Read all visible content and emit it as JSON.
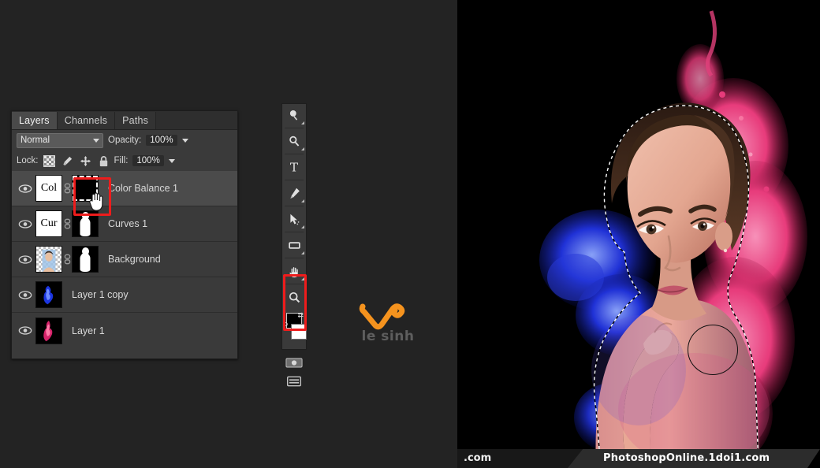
{
  "app": {
    "accent_red": "#ee1c1c",
    "panel_bg": "#3a3a3a",
    "workspace_bg": "#232323",
    "logo_orange": "#f5931e"
  },
  "layers_panel": {
    "tabs": [
      {
        "label": "Layers",
        "active": true
      },
      {
        "label": "Channels",
        "active": false
      },
      {
        "label": "Paths",
        "active": false
      }
    ],
    "blend_mode": "Normal",
    "opacity_label": "Opacity:",
    "opacity_value": "100%",
    "lock_label": "Lock:",
    "fill_label": "Fill:",
    "fill_value": "100%",
    "lock_icons": [
      "transparency-checker-icon",
      "brush-icon",
      "move-icon",
      "lock-all-icon"
    ],
    "layers": [
      {
        "name": "Color Balance 1",
        "thumb_text": "Col",
        "thumb_kind": "adjustment-text",
        "mask_kind": "black-empty",
        "selected": true,
        "visible": true,
        "mask_has_selection": true
      },
      {
        "name": "Curves 1",
        "thumb_text": "Cur",
        "thumb_kind": "adjustment-text",
        "mask_kind": "silhouette",
        "selected": false,
        "visible": true,
        "mask_has_selection": false
      },
      {
        "name": "Background",
        "thumb_text": "",
        "thumb_kind": "photo-portrait",
        "mask_kind": "silhouette",
        "selected": false,
        "visible": true,
        "mask_has_selection": false
      },
      {
        "name": "Layer 1 copy",
        "thumb_text": "",
        "thumb_kind": "photo-blue-ink",
        "mask_kind": "none",
        "selected": false,
        "visible": true,
        "mask_has_selection": false
      },
      {
        "name": "Layer 1",
        "thumb_text": "",
        "thumb_kind": "photo-pink-ink",
        "mask_kind": "none",
        "selected": false,
        "visible": true,
        "mask_has_selection": false
      }
    ]
  },
  "toolbar": {
    "tools": [
      "dodge-burn-icon",
      "blur-sharpen-icon",
      "type-icon",
      "pen-icon",
      "path-selection-icon",
      "shape-rectangle-icon",
      "hand-icon",
      "zoom-icon"
    ],
    "foreground_color": "#000000",
    "background_color": "#ffffff",
    "reset_label": "D",
    "swap_label": "⇄",
    "quickmask_icon": "quick-mask-icon",
    "screenmode_icon": "screen-mode-icon"
  },
  "annotations": {
    "mask_thumb_highlight": "red-rectangle-layer-mask",
    "swatches_highlight": "red-rectangle-color-swatches",
    "lock_row_highlight": "red-underline-lock-row",
    "cursor": "hand-cursor"
  },
  "watermark": {
    "logo_mark": "orange-check-v-mark",
    "logo_text": "le sinh"
  },
  "bottom_bar": {
    "left_text": ".com",
    "right_text": "PhotoshopOnline.1doi1.com"
  },
  "canvas": {
    "description": "portrait-with-ink-splash",
    "selection": "marching-ants-around-subject",
    "brush_cursor": "circle-brush-outline"
  }
}
